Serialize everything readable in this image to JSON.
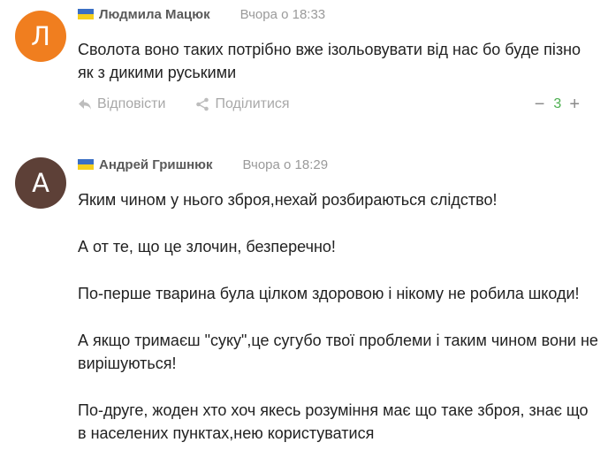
{
  "comments": [
    {
      "avatar_letter": "Л",
      "avatar_color": "#f07e1f",
      "author": "Людмила Мацюк",
      "time": "Вчора о 18:33",
      "paragraphs": [
        "Сволота воно таких потрібно  вже ізольовувати від нас бо буде пізно як з дикими руськими"
      ],
      "reply_label": "Відповісти",
      "share_label": "Поділитися",
      "vote_minus": "−",
      "score": "3",
      "vote_plus": "+"
    },
    {
      "avatar_letter": "А",
      "avatar_color": "#5d4037",
      "author": "Андрей Гришнюк",
      "time": "Вчора о 18:29",
      "paragraphs": [
        "Яким чином у нього зброя,нехай розбираються слідство!",
        "А от те, що це злочин, безперечно!",
        "По-перше тварина була цілком здоровою і нікому не робила шкоди!",
        "А якщо тримаєш \"суку\",це сугубо твої проблеми і таким чином вони не вирішуються!",
        "По-друге, жоден хто хоч якесь розуміння має що таке зброя, знає що в населених пунктах,нею користуватися"
      ]
    }
  ],
  "colors": {
    "flag_blue": "#3a6fc4",
    "flag_yellow": "#f5cf1d",
    "score_green": "#4caf50"
  },
  "icons": {
    "reply": "reply-arrow-icon",
    "share": "share-icon",
    "flag": "ukraine-flag-icon"
  }
}
